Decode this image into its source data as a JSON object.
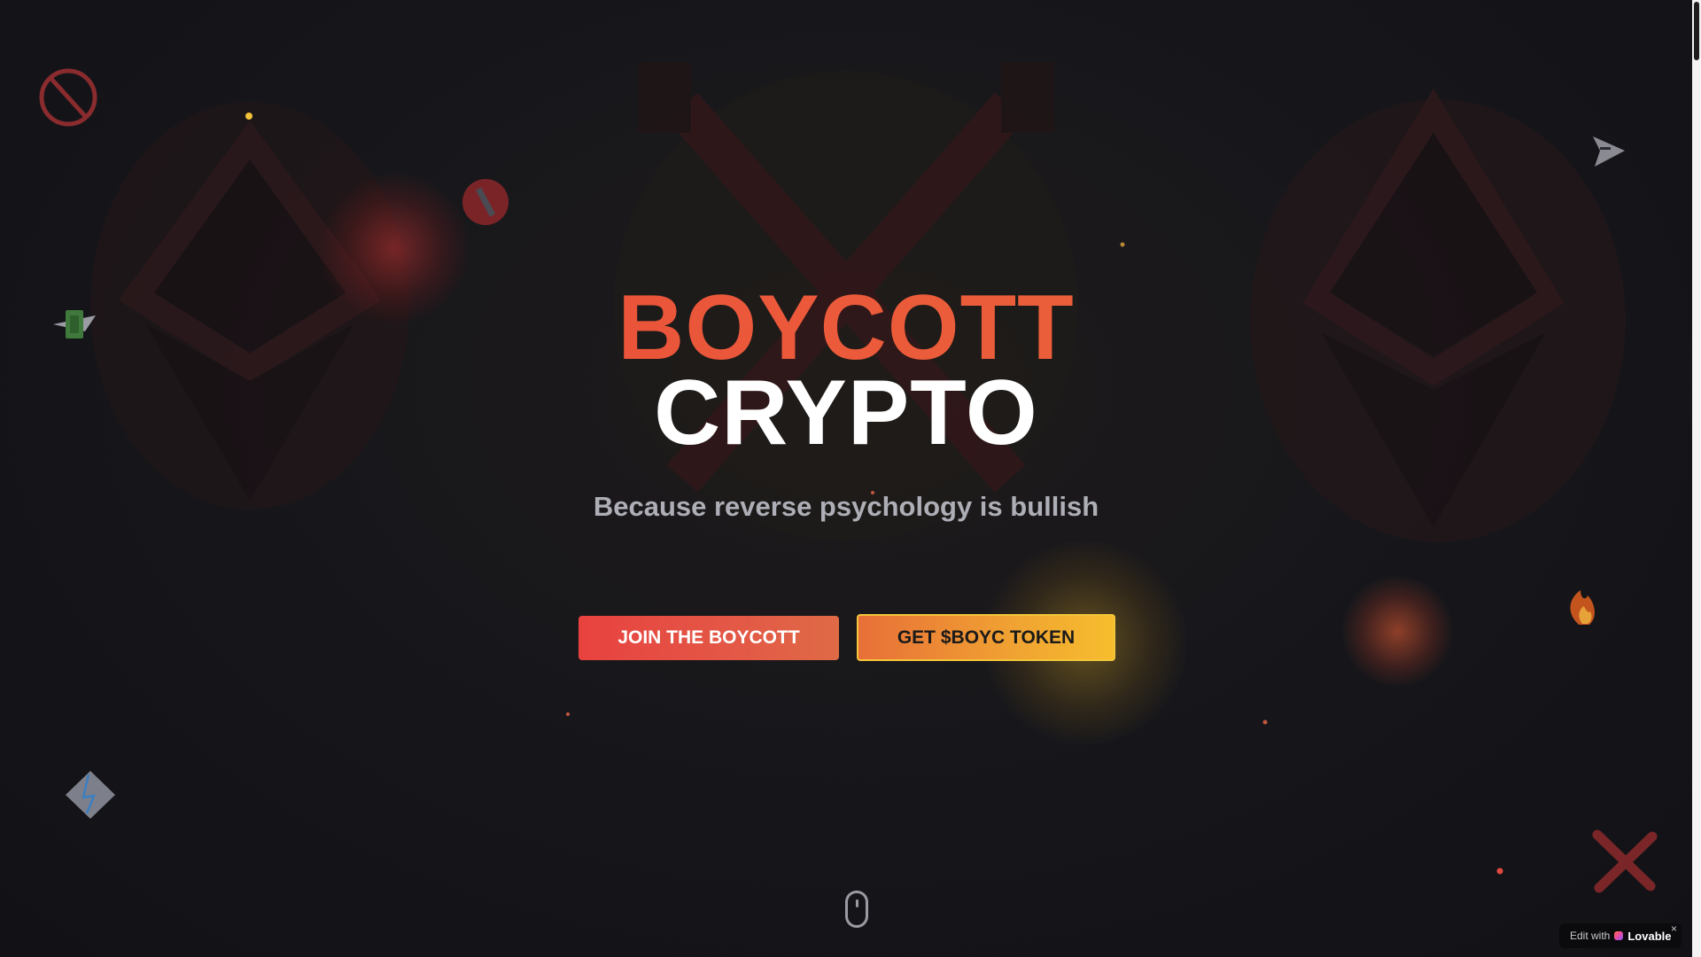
{
  "hero": {
    "title_line1": "BOYCOTT",
    "title_line2": "CRYPTO",
    "tagline": "Because reverse psychology is bullish"
  },
  "buttons": {
    "join_label": "JOIN THE BOYCOTT",
    "token_label": "GET $BOYC TOKEN"
  },
  "badge": {
    "prefix": "Edit with",
    "brand": "Lovable",
    "close": "×"
  },
  "decor_icons": [
    "prohibited-icon",
    "no-entry-icon",
    "money-icon",
    "paper-plane-icon",
    "fire-icon",
    "lightning-diamond-icon",
    "red-x-icon",
    "ethereum-icon",
    "x-circle-icon"
  ],
  "colors": {
    "accent_red": "#e8453c",
    "accent_orange": "#e96b3a",
    "accent_yellow": "#f6bd2e",
    "background": "#141418"
  }
}
